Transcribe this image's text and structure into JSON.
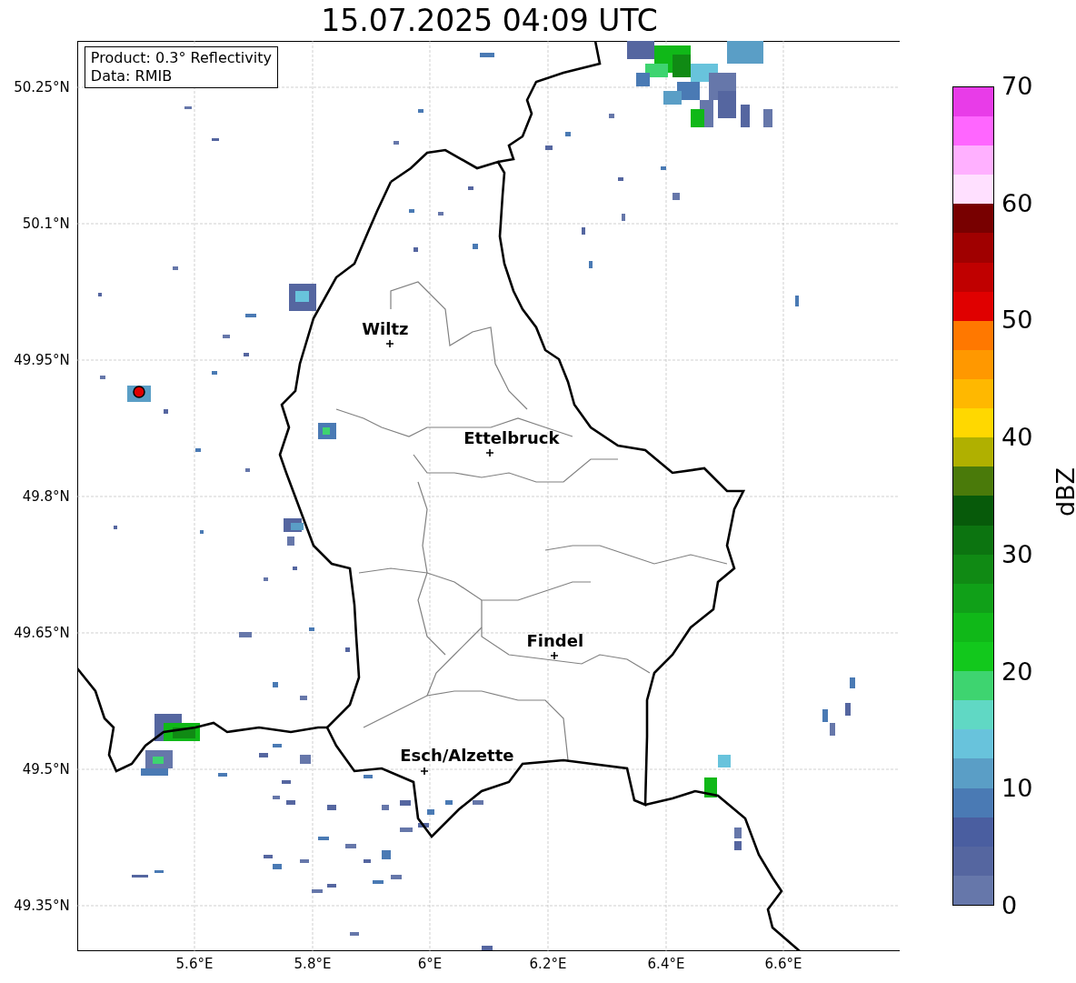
{
  "title": "15.07.2025 04:09 UTC",
  "legend": {
    "lines": [
      "Product: 0.3° Reflectivity",
      "Data: RMIB"
    ]
  },
  "y_axis": {
    "ticks": [
      "50.25°N",
      "50.1°N",
      "49.95°N",
      "49.8°N",
      "49.65°N",
      "49.5°N",
      "49.35°N"
    ]
  },
  "x_axis": {
    "ticks": [
      "5.6°E",
      "5.8°E",
      "6°E",
      "6.2°E",
      "6.4°E",
      "6.6°E"
    ]
  },
  "cities": [
    {
      "name": "Wiltz"
    },
    {
      "name": "Ettelbruck"
    },
    {
      "name": "Findel"
    },
    {
      "name": "Esch/Alzette"
    }
  ],
  "colorbar": {
    "label": "dBZ",
    "ticks": [
      "70",
      "60",
      "50",
      "40",
      "30",
      "20",
      "10",
      "0"
    ],
    "bins": [
      {
        "color": "#6677aa"
      },
      {
        "color": "#5566a0"
      },
      {
        "color": "#4a5ea0"
      },
      {
        "color": "#4a7ab4"
      },
      {
        "color": "#5a9ec6"
      },
      {
        "color": "#68c3dc"
      },
      {
        "color": "#60d8c4"
      },
      {
        "color": "#3ed470"
      },
      {
        "color": "#12c81c"
      },
      {
        "color": "#10b818"
      },
      {
        "color": "#10a018"
      },
      {
        "color": "#108a14"
      },
      {
        "color": "#0c7410"
      },
      {
        "color": "#075a0a"
      },
      {
        "color": "#4a7a0a"
      },
      {
        "color": "#b0b000"
      },
      {
        "color": "#ffd800"
      },
      {
        "color": "#ffb800"
      },
      {
        "color": "#ff9800"
      },
      {
        "color": "#ff7800"
      },
      {
        "color": "#e00000"
      },
      {
        "color": "#c00000"
      },
      {
        "color": "#a00000"
      },
      {
        "color": "#780000"
      },
      {
        "color": "#ffe0ff"
      },
      {
        "color": "#ffb0ff"
      },
      {
        "color": "#ff66ff"
      },
      {
        "color": "#e83ce8"
      }
    ]
  }
}
